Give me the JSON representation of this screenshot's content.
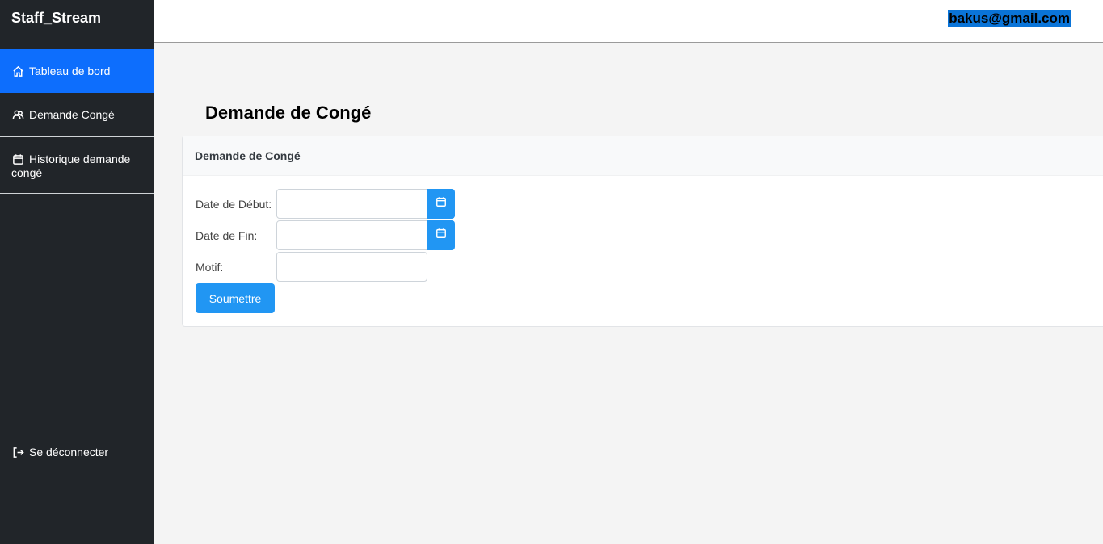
{
  "app": {
    "brand": "Staff_Stream"
  },
  "sidebar": {
    "items": [
      {
        "label": "Tableau de bord",
        "icon": "home-icon",
        "active": true
      },
      {
        "label": "Demande Congé",
        "icon": "users-icon"
      },
      {
        "label": "Historique demande congé",
        "icon": "calendar-icon"
      }
    ],
    "logout": {
      "label": "Se déconnecter",
      "icon": "logout-icon"
    }
  },
  "topbar": {
    "user_email": "bakus@gmail.com"
  },
  "main": {
    "page_title": "Demande de Congé",
    "card": {
      "header": "Demande de Congé",
      "fields": {
        "start_date": {
          "label": "Date de Début:",
          "value": ""
        },
        "end_date": {
          "label": "Date de Fin:",
          "value": ""
        },
        "reason": {
          "label": "Motif:",
          "value": ""
        }
      },
      "submit_label": "Soumettre"
    }
  },
  "colors": {
    "sidebar_bg": "#212529",
    "active": "#0d6efd",
    "accent": "#2196f3",
    "selection": "#0a74d8"
  }
}
